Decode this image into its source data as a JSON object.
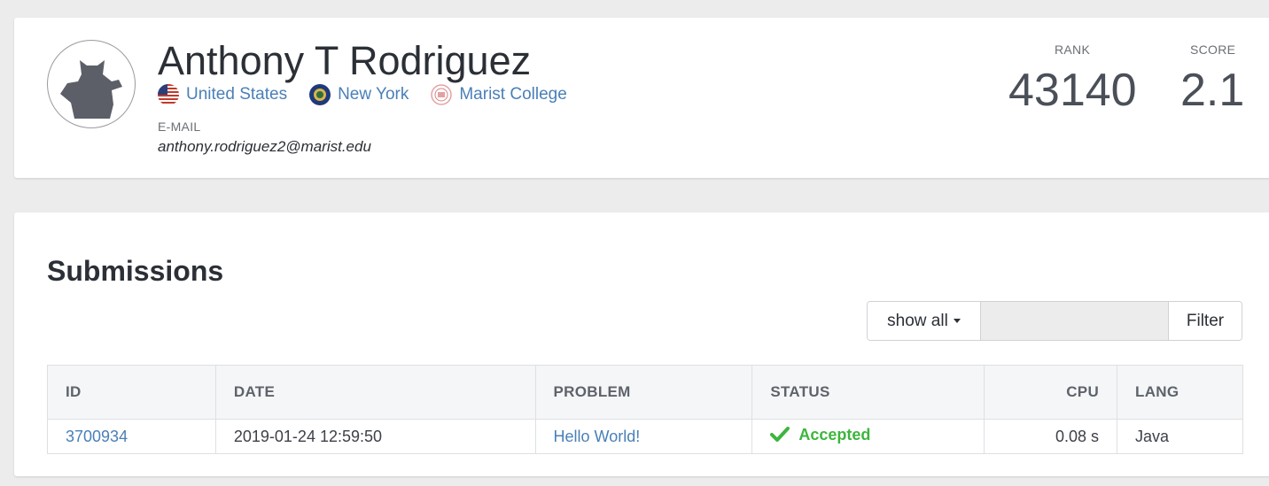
{
  "profile": {
    "name": "Anthony T Rodriguez",
    "locations": [
      {
        "label": "United States",
        "icon": "us-flag-icon"
      },
      {
        "label": "New York",
        "icon": "new-york-flag-icon"
      },
      {
        "label": "Marist College",
        "icon": "marist-college-seal-icon"
      }
    ],
    "email_label": "E-MAIL",
    "email": "anthony.rodriguez2@marist.edu",
    "rank_label": "RANK",
    "rank_value": "43140",
    "score_label": "SCORE",
    "score_value": "2.1"
  },
  "submissions": {
    "title": "Submissions",
    "filter": {
      "dropdown_label": "show all",
      "input_value": "",
      "button_label": "Filter"
    },
    "columns": [
      "ID",
      "DATE",
      "PROBLEM",
      "STATUS",
      "CPU",
      "LANG"
    ],
    "rows": [
      {
        "id": "3700934",
        "date": "2019-01-24 12:59:50",
        "problem": "Hello World!",
        "status": "Accepted",
        "cpu": "0.08 s",
        "lang": "Java"
      }
    ]
  },
  "colors": {
    "link": "#4a7fb8",
    "accepted": "#3db53d",
    "background": "#ececec",
    "text": "#2b2f36"
  }
}
